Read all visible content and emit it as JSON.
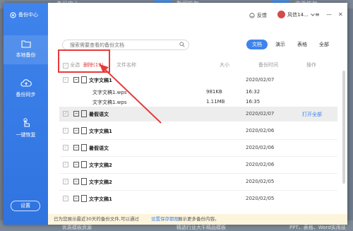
{
  "background": {
    "top_items": [
      "备份中心",
      "数据恢复",
      "文件恢复"
    ],
    "bottom_items": [
      "优质模板资源",
      "精选行业大牛精品模板",
      "PPT、表格、Word实用技"
    ]
  },
  "sidebar": {
    "brand": "备份中心",
    "items": [
      {
        "label": "本地备份",
        "icon": "folder-icon"
      },
      {
        "label": "备份同步",
        "icon": "cloud-upload-icon"
      },
      {
        "label": "一键恢复",
        "icon": "hand-pointer-icon"
      }
    ],
    "settings": "设置"
  },
  "titlebar": {
    "feedback": "反馈",
    "user": "风信14..."
  },
  "search": {
    "placeholder": "搜索需要查看的备份文档"
  },
  "filters": [
    "文档",
    "演示",
    "表格",
    "全部"
  ],
  "columns": {
    "select_all": "全选",
    "delete": "删除(19)",
    "filename": "文件名称",
    "size": "大小",
    "backup_time": "备份时间",
    "action": "操作"
  },
  "rows": [
    {
      "name": "文字文稿1",
      "date": "2020/02/07"
    },
    {
      "name": "暑假语文",
      "date": "2020/02/07",
      "action": "打开全部"
    },
    {
      "name": "文字文稿1",
      "date": "2020/02/06"
    },
    {
      "name": "暑假语文",
      "date": "2020/02/06"
    },
    {
      "name": "文字文稿2",
      "date": "2020/02/06"
    },
    {
      "name": "文字文稿2",
      "date": "2020/02/05"
    },
    {
      "name": "文字文稿1",
      "date": "2020/02/05"
    }
  ],
  "subrows": [
    {
      "name": "文字文稿1.wps",
      "size": "981KB",
      "time": "16:32"
    },
    {
      "name": "文字文稿1.wps",
      "size": "1.11MB",
      "time": "16:35"
    }
  ],
  "notice": {
    "pre": "已为您展示最近30天的备份文件,可以通过",
    "link": "设置保存期限",
    "post": "展示更多备份内容。"
  },
  "colors": {
    "accent": "#3f84ec",
    "highlight": "#e53b3b",
    "notice_bg": "#fdf4dc"
  }
}
